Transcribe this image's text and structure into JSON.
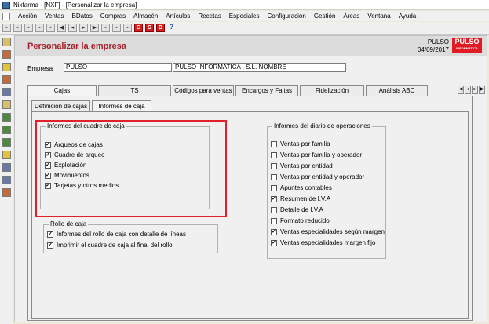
{
  "window": {
    "title": "Nixfarma - [NXF] - [Personalizar la empresa]"
  },
  "menu": [
    "Acción",
    "Ventas",
    "BDatos",
    "Compras",
    "Almacén",
    "Artículos",
    "Recetas",
    "Especiales",
    "Configuración",
    "Gestión",
    "Áreas",
    "Ventana",
    "Ayuda"
  ],
  "toolbar": {
    "icons": [
      "save-icon",
      "print-icon",
      "find-icon",
      "new-icon",
      "delete-icon",
      "first-icon",
      "prev-icon",
      "next-icon",
      "last-icon",
      "refresh-icon",
      "calc-icon",
      "edit-icon"
    ],
    "red_buttons": [
      "G",
      "S",
      "D"
    ],
    "help": "?"
  },
  "header": {
    "title": "Personalizar la empresa",
    "company": "PULSO",
    "date": "04/09/2017",
    "logo": "PULSO",
    "logo_sub": "INFORMATICA"
  },
  "empresa": {
    "label": "Empresa",
    "code": "PULSO",
    "name": "PULSO INFORMATICA , S.L.  NOMBRE"
  },
  "tabs": [
    "Cajas",
    "TS",
    "Códigos para ventas",
    "Encargos y Faltas",
    "Fidelización",
    "Análisis ABC"
  ],
  "subtabs": [
    "Definición de cajas",
    "Informes de caja"
  ],
  "cuadre": {
    "title": "Informes del cuadre de caja",
    "items": [
      {
        "label": "Arqueos de cajas",
        "checked": true
      },
      {
        "label": "Cuadre de arqueo",
        "checked": true
      },
      {
        "label": "Explotación",
        "checked": true
      },
      {
        "label": "Movimientos",
        "checked": true
      },
      {
        "label": "Tarjetas y otros medios",
        "checked": true
      }
    ]
  },
  "rollo": {
    "title": "Rollo de caja",
    "items": [
      {
        "label": "Informes del rollo de caja con detalle de líneas",
        "checked": true
      },
      {
        "label": "Imprimir el cuadre de caja al final del rollo",
        "checked": true
      }
    ]
  },
  "diario": {
    "title": "Informes del diario de operaciones",
    "items": [
      {
        "label": "Ventas por familia",
        "checked": false
      },
      {
        "label": "Ventas por familia y operador",
        "checked": false
      },
      {
        "label": "Ventas por entidad",
        "checked": false
      },
      {
        "label": "Ventas por entidad y operador",
        "checked": false
      },
      {
        "label": "Apuntes contables",
        "checked": false
      },
      {
        "label": "Resumen de I.V.A",
        "checked": true
      },
      {
        "label": "Detalle de I.V.A",
        "checked": false
      },
      {
        "label": "Formato reducido",
        "checked": false
      },
      {
        "label": "Ventas especialidades según margen",
        "checked": true
      },
      {
        "label": "Ventas especialidades margen fijo",
        "checked": true
      }
    ]
  },
  "colors": {
    "accent_title": "#a4202a",
    "highlight": "#e0202a",
    "logo_bg": "#e01b23"
  }
}
